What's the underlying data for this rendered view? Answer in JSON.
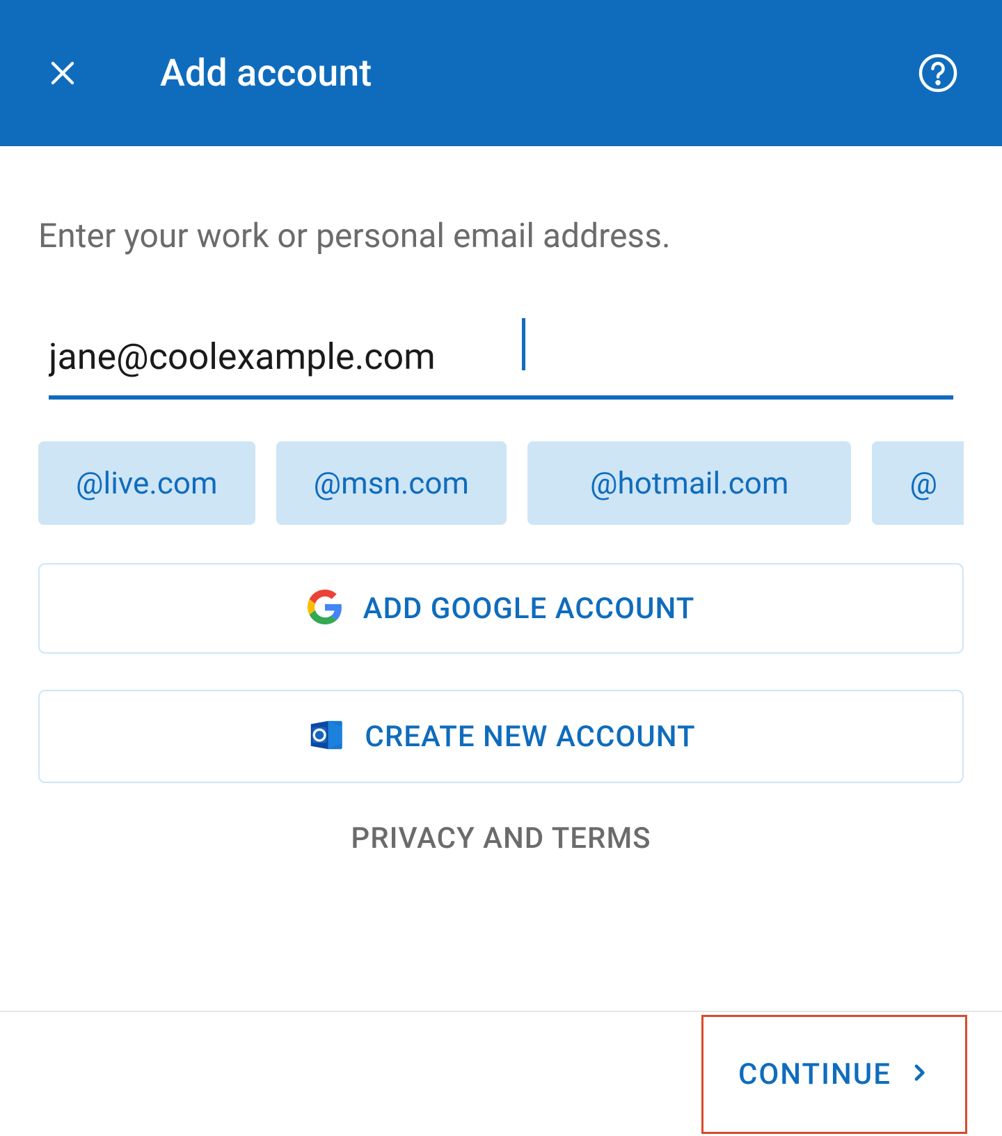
{
  "header": {
    "title": "Add account"
  },
  "content": {
    "prompt": "Enter your work or personal email address.",
    "email_value": "jane@coolexample.com",
    "domain_suggestions": [
      "@live.com",
      "@msn.com",
      "@hotmail.com",
      "@"
    ],
    "google_button_label": "ADD GOOGLE ACCOUNT",
    "create_button_label": "CREATE NEW ACCOUNT",
    "privacy_label": "PRIVACY AND TERMS"
  },
  "footer": {
    "continue_label": "CONTINUE"
  },
  "colors": {
    "primary": "#0f6cbd",
    "chip_bg": "#cee5f6",
    "highlight_border": "#d94a2b"
  }
}
